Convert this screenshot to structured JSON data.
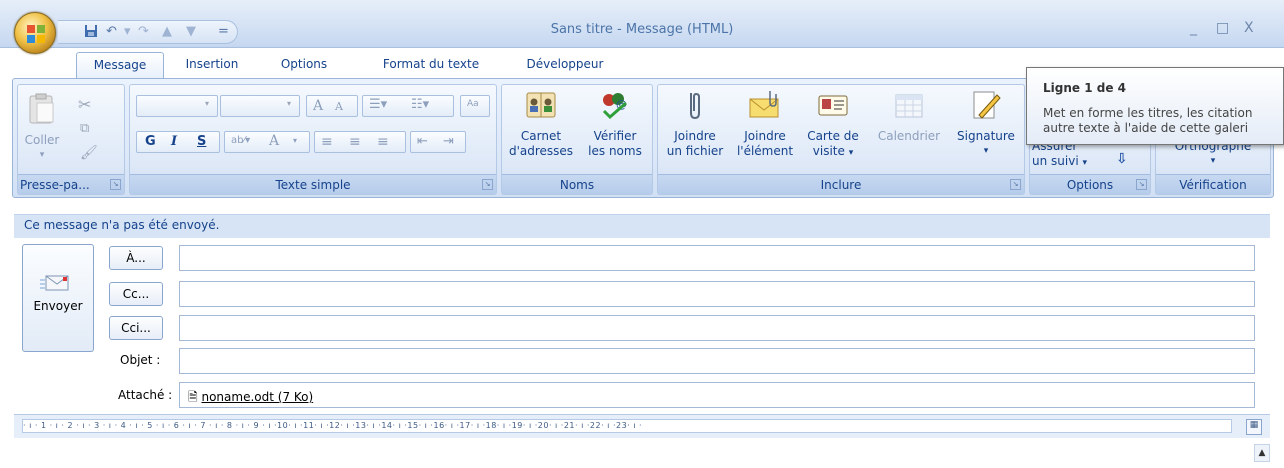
{
  "window": {
    "title": "Sans titre - Message (HTML)",
    "minimize": "_",
    "maximize": "□",
    "close": "X"
  },
  "qat": {
    "dropdown": "="
  },
  "tabs": [
    "Message",
    "Insertion",
    "Options",
    "Format du texte",
    "Développeur"
  ],
  "ribbon": {
    "clipboard": {
      "label": "Presse-pa...",
      "paste": "Coller"
    },
    "basic_text": {
      "label": "Texte simple",
      "bold": "G",
      "italic": "I",
      "underline": "S",
      "grow_font": "A",
      "shrink_font": "A",
      "font_color": "A"
    },
    "names": {
      "label": "Noms",
      "address_book_l1": "Carnet",
      "address_book_l2": "d'adresses",
      "check_names_l1": "Vérifier",
      "check_names_l2": "les noms"
    },
    "include": {
      "label": "Inclure",
      "attach_file_l1": "Joindre",
      "attach_file_l2": "un fichier",
      "attach_item_l1": "Joindre",
      "attach_item_l2": "l'élément",
      "business_card_l1": "Carte de",
      "business_card_l2": "visite",
      "calendar": "Calendrier",
      "signature": "Signature"
    },
    "options": {
      "label": "Options",
      "follow_up_l1": "Assurer",
      "follow_up_l2": "un suivi"
    },
    "proofing": {
      "label": "Vérification",
      "spelling": "Orthographe"
    }
  },
  "tooltip": {
    "title": "Ligne 1 de 4",
    "line1": "Met en forme les titres, les citation",
    "line2": "autre texte à l'aide de cette galeri"
  },
  "infobar": "Ce message n'a pas été envoyé.",
  "compose": {
    "send": "Envoyer",
    "to_btn": "À...",
    "cc_btn": "Cc...",
    "bcc_btn": "Cci...",
    "subject_label": "Objet :",
    "attached_label": "Attaché :",
    "attachment": "noname.odt (7 Ko)",
    "to_value": "",
    "cc_value": "",
    "bcc_value": "",
    "subject_value": ""
  },
  "ruler": {
    "marks": "· ı · 1 · ı · 2 · ı · 3 · ı · 4 · ı · 5 · ı · 6 · ı · 7 · ı · 8 · ı · 9 · ı ·10· ı ·11· ı ·12· ı ·13· ı ·14· ı ·15· ı ·16· ı ·17· ı ·18· ı ·19· ı ·20· ı ·21· ı ·22· ı ·23· ı ·"
  },
  "colors": {
    "accent": "#15428b",
    "ribbon_bg": "#dbe7f8",
    "infobar": "#d6e4f6"
  }
}
